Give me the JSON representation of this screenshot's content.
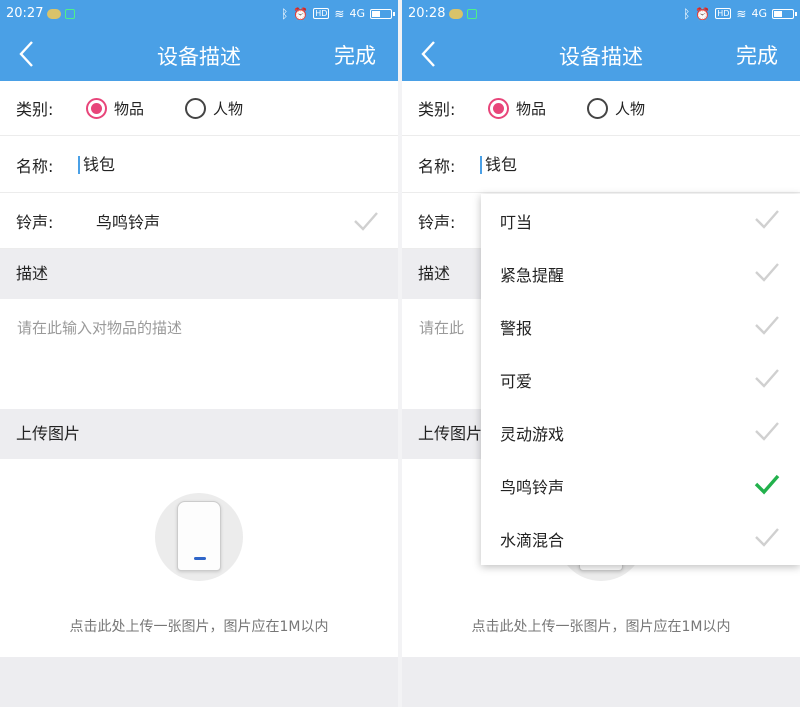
{
  "screens": [
    {
      "status": {
        "time": "20:27",
        "network": "4G"
      },
      "header": {
        "title": "设备描述",
        "done_label": "完成"
      },
      "category": {
        "label": "类别:",
        "options": [
          "物品",
          "人物"
        ],
        "selected": "物品"
      },
      "name": {
        "label": "名称:",
        "value": "钱包"
      },
      "ringtone": {
        "label": "铃声:",
        "value": "鸟鸣铃声"
      },
      "description": {
        "section_label": "描述",
        "placeholder": "请在此输入对物品的描述"
      },
      "upload": {
        "section_label": "上传图片",
        "hint": "点击此处上传一张图片，图片应在1M以内"
      }
    },
    {
      "status": {
        "time": "20:28",
        "network": "4G"
      },
      "header": {
        "title": "设备描述",
        "done_label": "完成"
      },
      "category": {
        "label": "类别:",
        "options": [
          "物品",
          "人物"
        ],
        "selected": "物品"
      },
      "name": {
        "label": "名称:",
        "value": "钱包"
      },
      "ringtone": {
        "label": "铃声:"
      },
      "description": {
        "section_label": "描述",
        "placeholder": "请在此"
      },
      "upload": {
        "section_label": "上传图片",
        "hint": "点击此处上传一张图片，图片应在1M以内"
      },
      "ringtone_menu": {
        "items": [
          "叮当",
          "紧急提醒",
          "警报",
          "可爱",
          "灵动游戏",
          "鸟鸣铃声",
          "水滴混合"
        ],
        "selected_index": 5
      }
    }
  ],
  "colors": {
    "accent": "#4aa0e6",
    "radio_selected": "#e8457a",
    "check_selected": "#22b14c",
    "check_inactive": "#d0d0d0"
  },
  "icons": {
    "back": "chevron-left-icon",
    "check": "check-icon"
  }
}
